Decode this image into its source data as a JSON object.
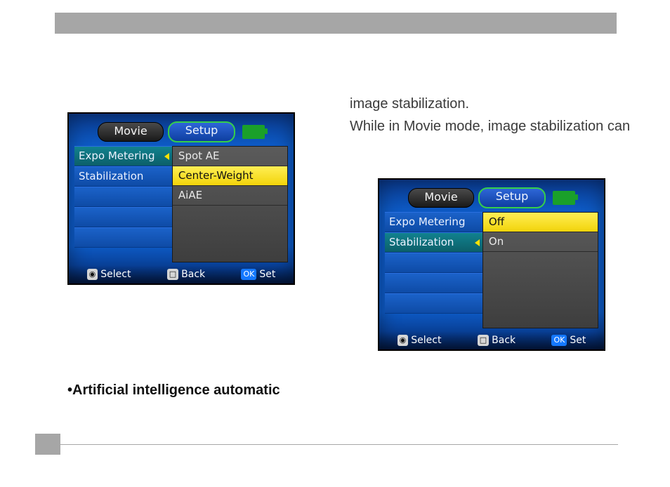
{
  "doc": {
    "body_line1": "image stabilization.",
    "body_line2": "While in Movie mode, image stabilization can",
    "bullet": "•Artificial intelligence automatic"
  },
  "lcd_common": {
    "tab_movie": "Movie",
    "tab_setup": "Setup",
    "footer_select_tag": "◉",
    "footer_select": "Select",
    "footer_back_tag": "□",
    "footer_back": "Back",
    "footer_set_tag": "OK",
    "footer_set": "Set"
  },
  "lcd1": {
    "left": [
      "Expo Metering",
      "Stabilization",
      "",
      "",
      ""
    ],
    "right": [
      "Spot AE",
      "Center-Weight",
      "AiAE"
    ],
    "active_left_index": 0,
    "highlight_right_index": 1
  },
  "lcd2": {
    "left": [
      "Expo Metering",
      "Stabilization",
      "",
      "",
      ""
    ],
    "right": [
      "Off",
      "On"
    ],
    "active_left_index": 1,
    "highlight_right_index": 0
  }
}
